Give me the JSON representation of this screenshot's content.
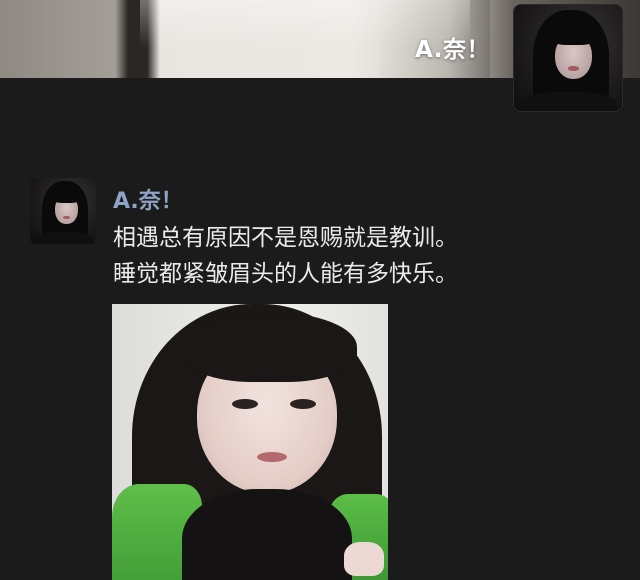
{
  "header": {
    "name": "A.奈！",
    "avatar_icon": "user-avatar-icon",
    "cover_icon": "cover-photo-icon"
  },
  "post": {
    "author": "A.奈！",
    "avatar_icon": "author-avatar-icon",
    "text_lines": [
      "相遇总有原因不是恩赐就是教训。",
      "睡觉都紧皱眉头的人能有多快乐。"
    ],
    "photo_icon": "post-photo-icon"
  },
  "colors": {
    "background": "#1b1b1b",
    "author_name": "#8fa3c7",
    "body_text": "#eaeaea",
    "header_name": "#ffffff"
  }
}
